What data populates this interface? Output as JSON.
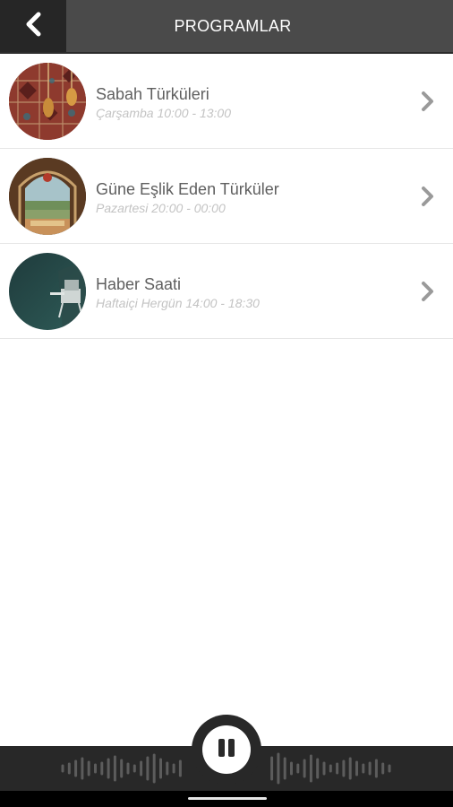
{
  "header": {
    "title": "PROGRAMLAR",
    "back_icon": "chevron-left-icon"
  },
  "programs": [
    {
      "title": "Sabah Türküleri",
      "schedule": "Çarşamba 10:00 - 13:00",
      "thumb": "baglama-carpet-image"
    },
    {
      "title": "Güne Eşlik Eden Türküler",
      "schedule": "Pazartesi 20:00 - 00:00",
      "thumb": "window-landscape-image"
    },
    {
      "title": "Haber Saati",
      "schedule": "Haftaiçi Hergün 14:00 - 18:30",
      "thumb": "studio-chair-image"
    }
  ],
  "player": {
    "state": "playing",
    "button_icon": "pause-icon",
    "background_icon": "sound-wave-icon"
  },
  "colors": {
    "header_bg": "#4a4a4a",
    "back_bg": "#262626",
    "player_bg": "#282828",
    "title_text": "#5f5f5f",
    "schedule_text": "#c3c3c3",
    "chevron": "#9a9a9a"
  }
}
